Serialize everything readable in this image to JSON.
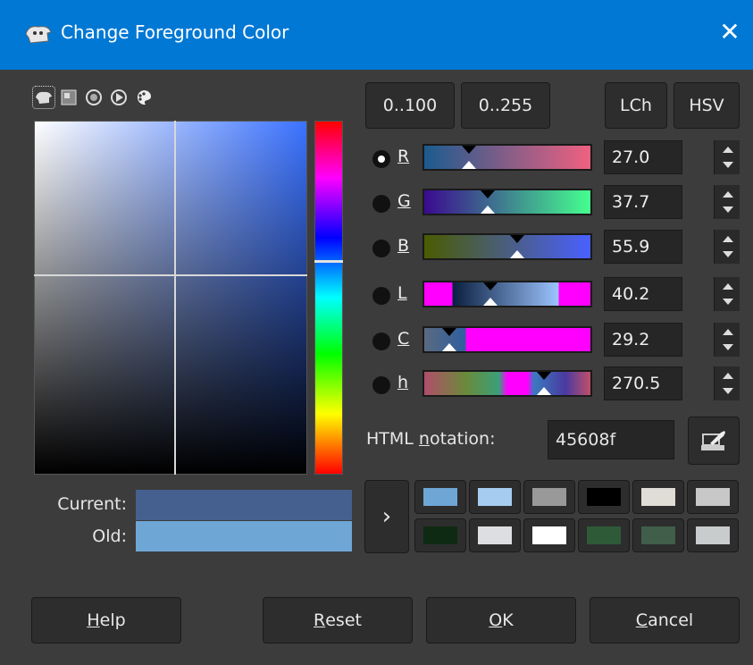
{
  "window": {
    "title": "Change Foreground Color",
    "close_icon": "close-icon"
  },
  "selector_tabs": [
    "gimp-selector-icon",
    "cmyk-selector-icon",
    "watercolor-selector-icon",
    "triangle-selector-icon",
    "palette-selector-icon"
  ],
  "range_buttons": {
    "percent": "0..100",
    "byte": "0..255"
  },
  "space_buttons": {
    "lch": "LCh",
    "hsv": "HSV"
  },
  "channels": [
    {
      "key": "R",
      "value": "27.0",
      "selected": true,
      "gradient": "linear-gradient(to right,#1b5b8f,#f06080)",
      "pos": 0.27
    },
    {
      "key": "G",
      "value": "37.7",
      "selected": false,
      "gradient": "linear-gradient(to right,#3a0a8f,#45ff8f)",
      "pos": 0.38
    },
    {
      "key": "B",
      "value": "55.9",
      "selected": false,
      "gradient": "linear-gradient(to right,#4a5c00,#4a60ff)",
      "pos": 0.56
    },
    {
      "key": "L",
      "value": "40.2",
      "selected": false,
      "gradient": "linear-gradient(to right,#ff00ff 0%,#ff00ff 17%,#0a1f3f 17%,#9cc4ff 81%,#ff00ff 81%,#ff00ff 100%)",
      "pos": 0.4
    },
    {
      "key": "C",
      "value": "29.2",
      "selected": false,
      "gradient": "linear-gradient(to right,#5a6a80 0%,#2e5fa0 25%,#ff00ff 25%,#ff00ff 100%)",
      "pos": 0.15
    },
    {
      "key": "h",
      "value": "270.5",
      "selected": false,
      "gradient": "linear-gradient(to right,#b04f6a 0%,#6a8a3a 25%,#3aa07a 45%,#ff00ff 50%,#ff00ff 62%,#3a7ac0 66%,#4a3aa0 85%,#c04f6a 100%)",
      "pos": 0.72
    }
  ],
  "html_notation": {
    "label_pre": "HTML ",
    "label_ul": "n",
    "label_post": "otation:",
    "value": "45608f"
  },
  "picker_icon": "eyedropper-icon",
  "preview": {
    "current_label": "Current:",
    "old_label": "Old:",
    "current_color": "#45608f",
    "old_color": "#6ea6d6"
  },
  "history": {
    "expand_icon": "chevron-right-icon",
    "colors": [
      "#6ea6d6",
      "#a6cdf0",
      "#999999",
      "#000000",
      "#e0dcd6",
      "#c8c8c8",
      "#0e2a12",
      "#dcdee2",
      "#ffffff",
      "#2e5a38",
      "#405e4a",
      "#c8cccc"
    ]
  },
  "buttons": {
    "help": {
      "ul": "H",
      "rest": "elp"
    },
    "reset": {
      "ul": "R",
      "rest": "eset"
    },
    "ok": {
      "ul": "O",
      "rest": "K"
    },
    "cancel": {
      "ul": "C",
      "rest": "ancel"
    }
  }
}
